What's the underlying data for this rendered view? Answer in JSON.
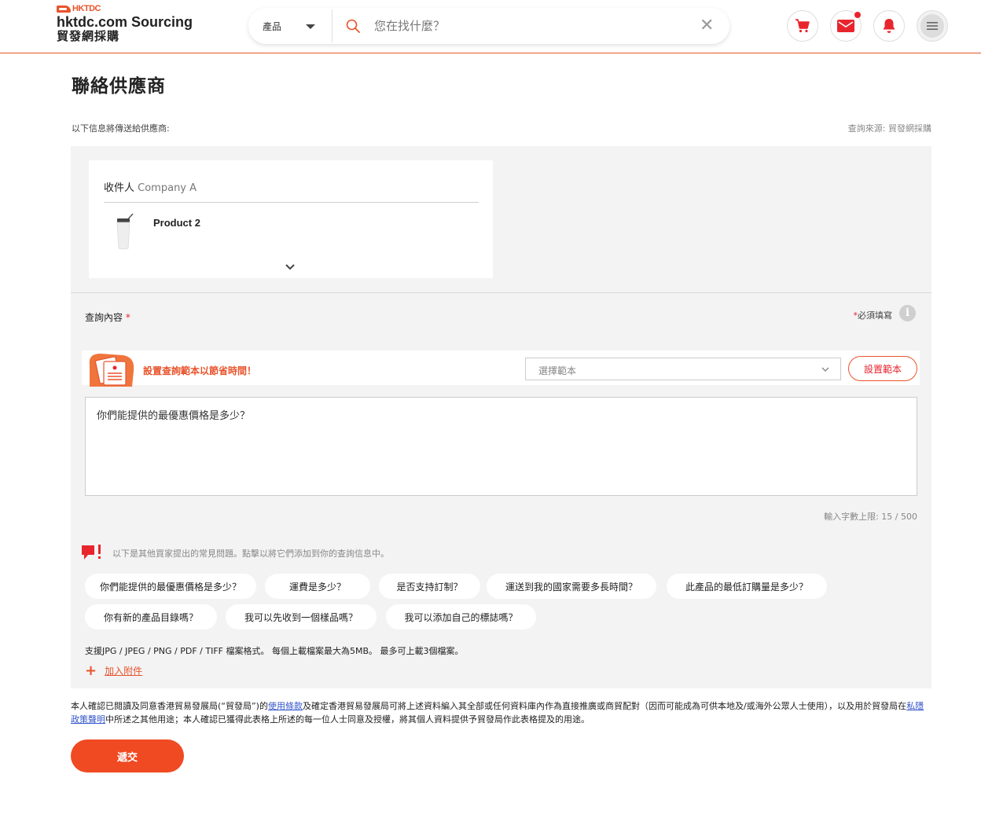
{
  "header": {
    "logo_brand": "HKTDC",
    "logo_main": "hktdc.com Sourcing",
    "logo_sub": "貿發網採購",
    "search": {
      "category": "產品",
      "placeholder": "您在找什麼？"
    },
    "icons": [
      "cart-icon",
      "mail-icon",
      "bell-icon",
      "menu-icon"
    ],
    "accent_color": "#e8542d"
  },
  "page": {
    "title": "聯絡供應商",
    "info_left": "以下信息將傳送給供應商:",
    "info_right": "查詢來源: 貿發網採購"
  },
  "recipient": {
    "label": "收件人",
    "company": "Company A",
    "product_name": "Product 2"
  },
  "inquiry": {
    "label": "查詢內容",
    "required_star": "*",
    "required_note": "必須填寫",
    "info_glyph": "i",
    "template_text": "設置查詢範本以節省時間！",
    "template_select_placeholder": "選擇範本",
    "template_button": "設置範本",
    "message": "你們能提供的最優惠價格是多少？",
    "char_count": "輸入字數上限: 15 / 500"
  },
  "faq": {
    "hint": "以下是其他買家提出的常見問題。點擊以將它們添加到你的查詢信息中。",
    "chips": [
      "你們能提供的最優惠價格是多少？",
      "運費是多少？",
      "是否支持訂制？",
      "運送到我的國家需要多長時間？",
      "此產品的最低訂購量是多少？",
      "你有新的產品目錄嗎？",
      "我可以先收到一個樣品嗎？",
      "我可以添加自己的標誌嗎？"
    ]
  },
  "attachments": {
    "note": "支援JPG / JPEG / PNG / PDF / TIFF 檔案格式。 每個上載檔案最大為5MB。 最多可上載3個檔案。",
    "add_label": "加入附件",
    "plus_glyph": "+"
  },
  "disclaimer": {
    "part1": "本人確認已閱讀及同意香港貿易發展局(“貿發局”)的",
    "terms_link": "使用條款",
    "part2": "及確定香港貿易發展局可將上述資料編入其全部或任何資料庫內作為直接推廣或商貿配對（因而可能成為可供本地及/或海外公眾人士使用），以及用於貿發局在",
    "privacy_link": "私隱政策聲明",
    "part3": "中所述之其他用途；本人確認已獲得此表格上所述的每一位人士同意及授權，將其個人資料提供予貿發局作此表格提及的用途。"
  },
  "submit_label": "遞交"
}
